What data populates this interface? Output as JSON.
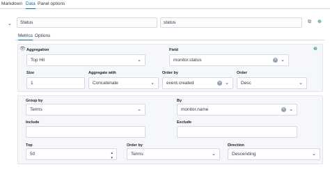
{
  "tabs": [
    "Markdown",
    "Data",
    "Panel options"
  ],
  "series": {
    "label_value": "Status",
    "var_name_value": "status"
  },
  "subtabs": [
    "Metrics",
    "Options"
  ],
  "metric": {
    "aggregation": {
      "label": "Aggregation",
      "value": "Top Hit"
    },
    "field": {
      "label": "Field",
      "value": "monitor.status"
    },
    "size": {
      "label": "Size",
      "value": "1"
    },
    "aggregate_with": {
      "label": "Aggregate with",
      "value": "Concatenate"
    },
    "order_by": {
      "label": "Order by",
      "value": "event.created"
    },
    "order": {
      "label": "Order",
      "value": "Desc"
    }
  },
  "grouping": {
    "group_by": {
      "label": "Group by",
      "value": "Terms"
    },
    "by": {
      "label": "By",
      "value": "monitor.name"
    },
    "include": {
      "label": "Include",
      "value": ""
    },
    "exclude": {
      "label": "Exclude",
      "value": ""
    },
    "top": {
      "label": "Top",
      "value": "50"
    },
    "order_by": {
      "label": "Order by",
      "value": "Terms"
    },
    "direction": {
      "label": "Direction",
      "value": "Descending"
    }
  },
  "icons": {
    "chevron_down": "chevron-down-icon",
    "clone": "copy-icon",
    "add": "plus-circle-icon",
    "eye": "eye-icon",
    "clear": "clear-icon",
    "stepper": "number-stepper-icon"
  },
  "colors": {
    "accent": "#006bb4",
    "success": "#017d73",
    "panel_bg": "#f5f7fa",
    "border": "#d3dae6"
  }
}
